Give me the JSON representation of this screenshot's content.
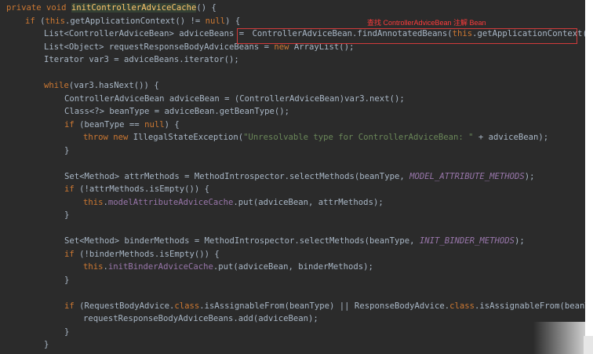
{
  "annotation": "查找 ControllerAdviceBean 注解 Bean",
  "code": {
    "l1_kw": "private void ",
    "l1_fn": "initControllerAdviceCache",
    "l1_rest": "() {",
    "l2_kw1": "if",
    "l2_a": " (",
    "l2_kw2": "this",
    "l2_b": ".getApplicationContext() != ",
    "l2_kw3": "null",
    "l2_c": ") {",
    "l3_a": "List<ControllerAdviceBean> adviceBeans = ",
    "l3_b": "ControllerAdviceBean.findAnnotatedBeans(",
    "l3_kw": "this",
    "l3_c": ".getApplicationContext());",
    "l4_a": "List<Object> requestResponseBodyAdviceBeans = ",
    "l4_kw": "new",
    "l4_b": " ArrayList();",
    "l5": "Iterator var3 = adviceBeans.iterator();",
    "l7_kw": "while",
    "l7_rest": "(var3.hasNext()) {",
    "l8": "ControllerAdviceBean adviceBean = (ControllerAdviceBean)var3.next();",
    "l9": "Class<?> beanType = adviceBean.getBeanType();",
    "l10_kw": "if",
    "l10_a": " (beanType == ",
    "l10_kw2": "null",
    "l10_b": ") {",
    "l11_kw1": "throw new",
    "l11_a": " IllegalStateException(",
    "l11_str": "\"Unresolvable type for ControllerAdviceBean: \"",
    "l11_b": " + adviceBean);",
    "l12": "}",
    "l14_a": "Set<Method> attrMethods = MethodIntrospector.selectMethods(beanType, ",
    "l14_const": "MODEL_ATTRIBUTE_METHODS",
    "l14_b": ");",
    "l15_kw": "if",
    "l15_a": " (!attrMethods.isEmpty()) {",
    "l16_kw": "this",
    "l16_a": ".",
    "l16_fld": "modelAttributeAdviceCache",
    "l16_b": ".put(adviceBean, attrMethods);",
    "l17": "}",
    "l19_a": "Set<Method> binderMethods = MethodIntrospector.selectMethods(beanType, ",
    "l19_const": "INIT_BINDER_METHODS",
    "l19_b": ");",
    "l20_kw": "if",
    "l20_a": " (!binderMethods.isEmpty()) {",
    "l21_kw": "this",
    "l21_a": ".",
    "l21_fld": "initBinderAdviceCache",
    "l21_b": ".put(adviceBean, binderMethods);",
    "l22": "}",
    "l24_kw": "if",
    "l24_a": " (RequestBodyAdvice.",
    "l24_kw2": "class",
    "l24_b": ".isAssignableFrom(beanType) || ResponseBodyAdvice.",
    "l24_kw3": "class",
    "l24_c": ".isAssignableFrom(beanType))",
    "l25": "requestResponseBodyAdviceBeans.add(adviceBean);",
    "l26": "}",
    "l27": "}"
  },
  "colors": {
    "background": "#2b2b2b",
    "keyword": "#cc7832",
    "method_decl": "#ffc66d",
    "string": "#6a8759",
    "field": "#9876aa",
    "text": "#a9b7c6",
    "highlight_box": "#d23b3b"
  }
}
